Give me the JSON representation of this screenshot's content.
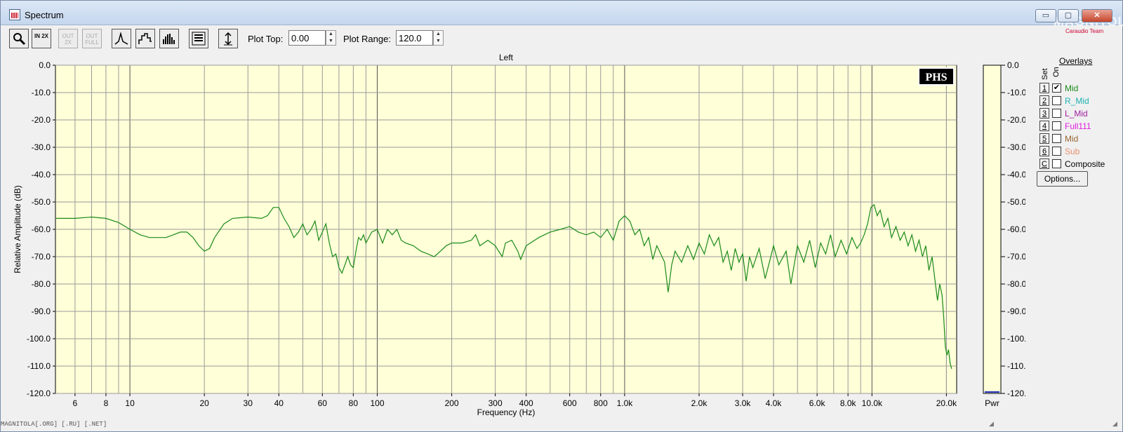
{
  "window": {
    "title": "Spectrum",
    "icon": "spectrum-app-icon"
  },
  "watermark": {
    "text": "MAGNITOLA",
    "sub": "Caraudio Team"
  },
  "titlebar_buttons": {
    "minimize": "▭",
    "maximize": "▢",
    "close": "✕"
  },
  "toolbar": {
    "buttons": [
      {
        "name": "zoom-button",
        "icon": "magnifier-icon",
        "label": ""
      },
      {
        "name": "zoom-in-2x-button",
        "icon": "zoom-in-icon",
        "label": "IN 2X"
      },
      {
        "name": "zoom-out-2x-button",
        "icon": "zoom-out-icon",
        "label": "OUT 2X",
        "disabled": true
      },
      {
        "name": "zoom-out-full-button",
        "icon": "zoom-full-icon",
        "label": "OUT FULL",
        "disabled": true
      },
      {
        "name": "line-plot-button",
        "icon": "line-plot-icon",
        "label": ""
      },
      {
        "name": "step-plot-button",
        "icon": "step-plot-icon",
        "label": ""
      },
      {
        "name": "bar-plot-button",
        "icon": "bar-plot-icon",
        "label": ""
      },
      {
        "name": "settings-panel-button",
        "icon": "panel-icon",
        "label": ""
      },
      {
        "name": "autoscale-button",
        "icon": "vertical-range-icon",
        "label": ""
      }
    ],
    "plot_top_label": "Plot Top:",
    "plot_top_value": "0.00",
    "plot_range_label": "Plot Range:",
    "plot_range_value": "120.0"
  },
  "overlays": {
    "title": "Overlays",
    "set_header": "Set",
    "on_header": "On",
    "rows": [
      {
        "num": "1",
        "checked": true,
        "name": "Mid",
        "color": "#1a8a1a"
      },
      {
        "num": "2",
        "checked": false,
        "name": "R_Mid",
        "color": "#20b0b0"
      },
      {
        "num": "3",
        "checked": false,
        "name": "L_Mid",
        "color": "#a020a0"
      },
      {
        "num": "4",
        "checked": false,
        "name": "Full111",
        "color": "#e020e0"
      },
      {
        "num": "5",
        "checked": false,
        "name": "Mid",
        "color": "#996633"
      },
      {
        "num": "6",
        "checked": false,
        "name": "Sub",
        "color": "#e89070"
      },
      {
        "num": "C",
        "checked": false,
        "name": "Composite",
        "color": "#000000"
      }
    ],
    "options_label": "Options..."
  },
  "status_text": "MAGNITOLA[.ORG] [.RU] [.NET]",
  "chart_data": {
    "type": "line",
    "title": "Left",
    "xlabel": "Frequency (Hz)",
    "ylabel": "Relative Amplitude (dB)",
    "x_scale": "log",
    "xlim": [
      5,
      22000
    ],
    "ylim": [
      -120,
      0
    ],
    "grid": true,
    "background": "#ffffd8",
    "x_ticks": [
      {
        "v": 6,
        "label": "6"
      },
      {
        "v": 8,
        "label": "8"
      },
      {
        "v": 10,
        "label": "10"
      },
      {
        "v": 20,
        "label": "20"
      },
      {
        "v": 30,
        "label": "30"
      },
      {
        "v": 40,
        "label": "40"
      },
      {
        "v": 60,
        "label": "60"
      },
      {
        "v": 80,
        "label": "80"
      },
      {
        "v": 100,
        "label": "100"
      },
      {
        "v": 200,
        "label": "200"
      },
      {
        "v": 300,
        "label": "300"
      },
      {
        "v": 400,
        "label": "400"
      },
      {
        "v": 600,
        "label": "600"
      },
      {
        "v": 800,
        "label": "800"
      },
      {
        "v": 1000,
        "label": "1.0k"
      },
      {
        "v": 2000,
        "label": "2.0k"
      },
      {
        "v": 3000,
        "label": "3.0k"
      },
      {
        "v": 4000,
        "label": "4.0k"
      },
      {
        "v": 6000,
        "label": "6.0k"
      },
      {
        "v": 8000,
        "label": "8.0k"
      },
      {
        "v": 10000,
        "label": "10.0k"
      },
      {
        "v": 20000,
        "label": "20.0k"
      }
    ],
    "y_ticks": [
      {
        "v": 0,
        "label": "0.0"
      },
      {
        "v": -10,
        "label": "-10.0"
      },
      {
        "v": -20,
        "label": "-20.0"
      },
      {
        "v": -30,
        "label": "-30.0"
      },
      {
        "v": -40,
        "label": "-40.0"
      },
      {
        "v": -50,
        "label": "-50.0"
      },
      {
        "v": -60,
        "label": "-60.0"
      },
      {
        "v": -70,
        "label": "-70.0"
      },
      {
        "v": -80,
        "label": "-80.0"
      },
      {
        "v": -90,
        "label": "-90.0"
      },
      {
        "v": -100,
        "label": "-100.0"
      },
      {
        "v": -110,
        "label": "-110.0"
      },
      {
        "v": -120,
        "label": "-120.0"
      }
    ],
    "right_y_ticks": [
      {
        "v": 0,
        "label": "0.0"
      },
      {
        "v": -10,
        "label": "-10.0"
      },
      {
        "v": -20,
        "label": "-20.0"
      },
      {
        "v": -30,
        "label": "-30.0"
      },
      {
        "v": -40,
        "label": "-40.0"
      },
      {
        "v": -50,
        "label": "-50.0"
      },
      {
        "v": -60,
        "label": "-60.0"
      },
      {
        "v": -70,
        "label": "-70.0"
      },
      {
        "v": -80,
        "label": "-80.0"
      },
      {
        "v": -90,
        "label": "-90.0"
      },
      {
        "v": -100,
        "label": "-100.0"
      },
      {
        "v": -110,
        "label": "-110.0"
      },
      {
        "v": -120,
        "label": "-120.0"
      }
    ],
    "pwr_label": "Pwr",
    "logo_text": "PHS",
    "series": [
      {
        "name": "Mid",
        "color": "#1a8a1a",
        "points": [
          [
            5,
            -56
          ],
          [
            6,
            -56
          ],
          [
            7,
            -55.5
          ],
          [
            8,
            -56
          ],
          [
            9,
            -57.5
          ],
          [
            10,
            -60
          ],
          [
            11,
            -62
          ],
          [
            12,
            -63
          ],
          [
            13,
            -63
          ],
          [
            14,
            -63
          ],
          [
            15,
            -62
          ],
          [
            16,
            -61
          ],
          [
            17,
            -61
          ],
          [
            18,
            -63
          ],
          [
            19,
            -66
          ],
          [
            20,
            -68
          ],
          [
            21,
            -67
          ],
          [
            22,
            -63
          ],
          [
            24,
            -58
          ],
          [
            26,
            -56
          ],
          [
            30,
            -55.5
          ],
          [
            34,
            -56
          ],
          [
            36,
            -55
          ],
          [
            38,
            -52
          ],
          [
            40,
            -52
          ],
          [
            42,
            -56
          ],
          [
            44,
            -59
          ],
          [
            46,
            -63
          ],
          [
            48,
            -61
          ],
          [
            50,
            -58
          ],
          [
            52,
            -62
          ],
          [
            54,
            -60
          ],
          [
            56,
            -57
          ],
          [
            58,
            -64
          ],
          [
            60,
            -61
          ],
          [
            62,
            -58
          ],
          [
            64,
            -65
          ],
          [
            66,
            -70
          ],
          [
            68,
            -69
          ],
          [
            70,
            -74
          ],
          [
            72,
            -76
          ],
          [
            74,
            -73
          ],
          [
            76,
            -70
          ],
          [
            78,
            -73
          ],
          [
            80,
            -74
          ],
          [
            82,
            -68
          ],
          [
            84,
            -63
          ],
          [
            86,
            -64
          ],
          [
            88,
            -62
          ],
          [
            90,
            -65
          ],
          [
            95,
            -61
          ],
          [
            100,
            -60
          ],
          [
            105,
            -65
          ],
          [
            110,
            -60
          ],
          [
            115,
            -62
          ],
          [
            120,
            -60
          ],
          [
            125,
            -64
          ],
          [
            130,
            -65
          ],
          [
            140,
            -66
          ],
          [
            150,
            -68
          ],
          [
            160,
            -69
          ],
          [
            170,
            -70
          ],
          [
            180,
            -68
          ],
          [
            190,
            -66
          ],
          [
            200,
            -65
          ],
          [
            220,
            -65
          ],
          [
            240,
            -64
          ],
          [
            250,
            -62
          ],
          [
            260,
            -66
          ],
          [
            280,
            -64
          ],
          [
            300,
            -66
          ],
          [
            320,
            -70
          ],
          [
            330,
            -65
          ],
          [
            350,
            -64
          ],
          [
            370,
            -68
          ],
          [
            380,
            -71
          ],
          [
            400,
            -66
          ],
          [
            450,
            -63
          ],
          [
            500,
            -61
          ],
          [
            550,
            -60
          ],
          [
            600,
            -59
          ],
          [
            650,
            -61
          ],
          [
            700,
            -62
          ],
          [
            750,
            -61
          ],
          [
            800,
            -63
          ],
          [
            850,
            -60
          ],
          [
            900,
            -64
          ],
          [
            950,
            -57
          ],
          [
            1000,
            -55
          ],
          [
            1050,
            -57
          ],
          [
            1100,
            -62
          ],
          [
            1150,
            -60
          ],
          [
            1200,
            -66
          ],
          [
            1250,
            -63
          ],
          [
            1300,
            -71
          ],
          [
            1350,
            -66
          ],
          [
            1400,
            -69
          ],
          [
            1450,
            -72
          ],
          [
            1500,
            -83
          ],
          [
            1550,
            -73
          ],
          [
            1600,
            -68
          ],
          [
            1700,
            -72
          ],
          [
            1800,
            -66
          ],
          [
            1900,
            -71
          ],
          [
            2000,
            -65
          ],
          [
            2100,
            -69
          ],
          [
            2200,
            -62
          ],
          [
            2300,
            -66
          ],
          [
            2400,
            -63
          ],
          [
            2500,
            -72
          ],
          [
            2600,
            -68
          ],
          [
            2700,
            -75
          ],
          [
            2800,
            -67
          ],
          [
            2900,
            -72
          ],
          [
            3000,
            -69
          ],
          [
            3100,
            -79
          ],
          [
            3200,
            -70
          ],
          [
            3300,
            -74
          ],
          [
            3500,
            -67
          ],
          [
            3700,
            -78
          ],
          [
            3900,
            -70
          ],
          [
            4000,
            -66
          ],
          [
            4200,
            -73
          ],
          [
            4500,
            -68
          ],
          [
            4700,
            -80
          ],
          [
            5000,
            -66
          ],
          [
            5300,
            -72
          ],
          [
            5600,
            -64
          ],
          [
            5900,
            -74
          ],
          [
            6200,
            -65
          ],
          [
            6500,
            -69
          ],
          [
            6800,
            -62
          ],
          [
            7100,
            -70
          ],
          [
            7500,
            -64
          ],
          [
            7900,
            -69
          ],
          [
            8300,
            -63
          ],
          [
            8700,
            -67
          ],
          [
            9000,
            -65
          ],
          [
            9300,
            -62
          ],
          [
            9600,
            -58
          ],
          [
            9900,
            -52
          ],
          [
            10200,
            -51
          ],
          [
            10500,
            -55
          ],
          [
            10800,
            -53
          ],
          [
            11200,
            -59
          ],
          [
            11600,
            -56
          ],
          [
            12000,
            -63
          ],
          [
            12500,
            -59
          ],
          [
            13000,
            -64
          ],
          [
            13500,
            -61
          ],
          [
            14000,
            -66
          ],
          [
            14500,
            -62
          ],
          [
            15000,
            -68
          ],
          [
            15500,
            -64
          ],
          [
            16000,
            -70
          ],
          [
            16500,
            -66
          ],
          [
            17000,
            -75
          ],
          [
            17500,
            -70
          ],
          [
            18000,
            -79
          ],
          [
            18400,
            -86
          ],
          [
            18800,
            -80
          ],
          [
            19200,
            -84
          ],
          [
            19500,
            -92
          ],
          [
            19800,
            -103
          ],
          [
            20100,
            -106
          ],
          [
            20400,
            -104
          ],
          [
            20700,
            -109
          ],
          [
            21000,
            -111
          ]
        ]
      }
    ]
  }
}
